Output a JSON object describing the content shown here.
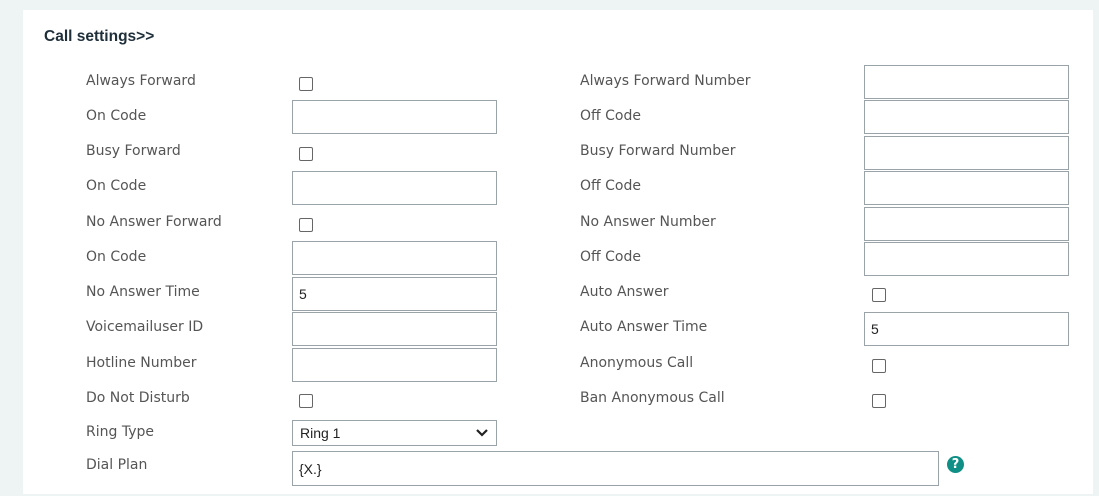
{
  "section": {
    "title": "Call settings>>"
  },
  "left": {
    "always_forward": "Always Forward",
    "on_code_1": "On Code",
    "busy_forward": "Busy Forward",
    "on_code_2": "On Code",
    "no_answer_forward": "No Answer Forward",
    "on_code_3": "On Code",
    "no_answer_time": "No Answer Time",
    "no_answer_time_value": "5",
    "voicemail_user_id": "Voicemailuser ID",
    "hotline_number": "Hotline Number",
    "do_not_disturb": "Do Not Disturb",
    "ring_type": "Ring Type",
    "ring_type_value": "Ring 1",
    "dial_plan": "Dial Plan",
    "dial_plan_value": "{X.}"
  },
  "right": {
    "always_forward_number": "Always Forward Number",
    "off_code_1": "Off Code",
    "busy_forward_number": "Busy Forward Number",
    "off_code_2": "Off Code",
    "no_answer_number": "No Answer Number",
    "off_code_3": "Off Code",
    "auto_answer": "Auto Answer",
    "auto_answer_time": "Auto Answer Time",
    "auto_answer_time_value": "5",
    "anonymous_call": "Anonymous Call",
    "ban_anonymous_call": "Ban Anonymous Call"
  },
  "icons": {
    "help": "question-mark-help-icon",
    "select": "chevron-down-icon"
  },
  "colors": {
    "help_icon": "#0f8f85",
    "background": "#eef3f3",
    "panel": "#ffffff"
  }
}
